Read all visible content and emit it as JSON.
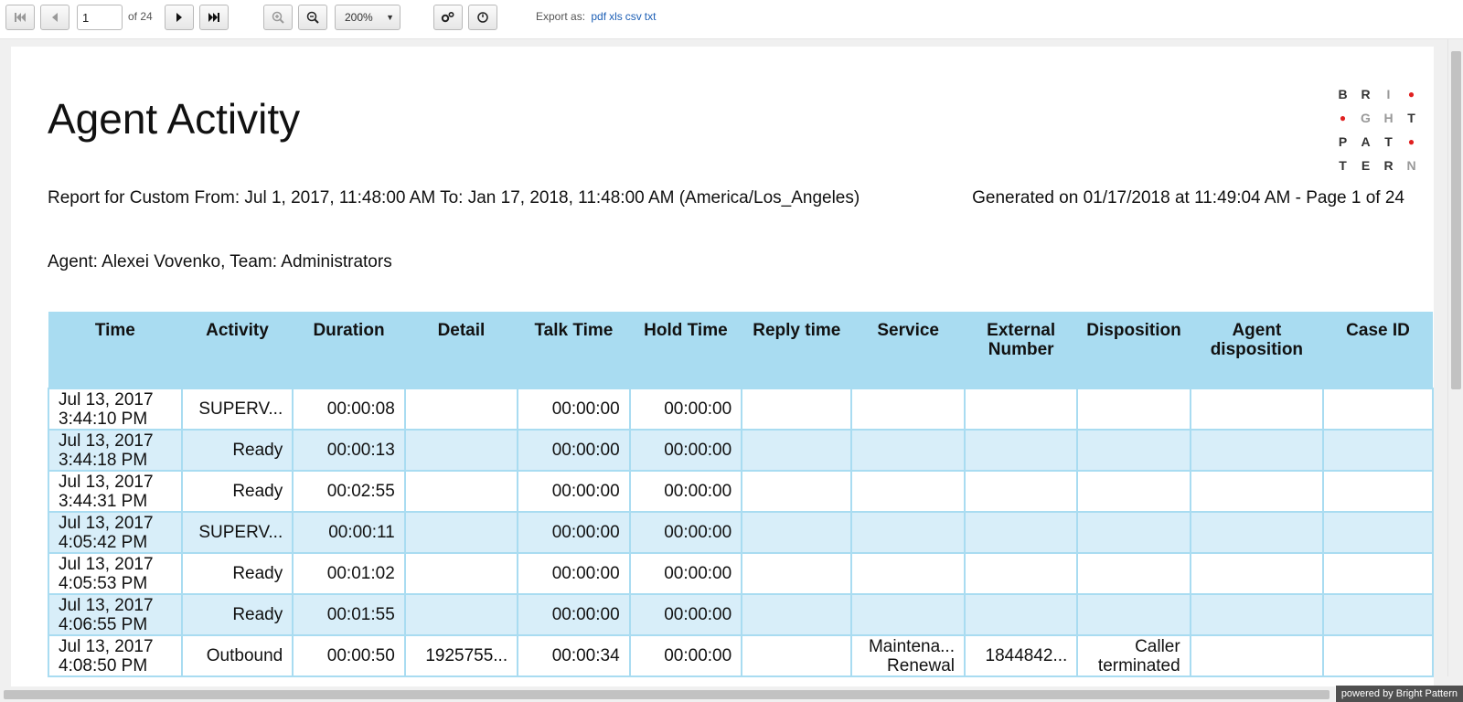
{
  "toolbar": {
    "page_value": "1",
    "page_of": "of 24",
    "zoom": "200%",
    "export_label": "Export as:",
    "export_formats": [
      "pdf",
      "xls",
      "csv",
      "txt"
    ],
    "icons": {
      "first": "first-page-icon",
      "prev": "prev-page-icon",
      "next": "next-page-icon",
      "last": "last-page-icon",
      "zoom_in": "zoom-in-icon",
      "zoom_out": "zoom-out-icon",
      "settings": "settings-icon",
      "refresh": "refresh-icon"
    }
  },
  "report": {
    "title": "Agent Activity",
    "range": "Report for Custom From: Jul 1, 2017, 11:48:00 AM To: Jan 17, 2018, 11:48:00 AM (America/Los_Angeles)",
    "generated": "Generated on 01/17/2018 at 11:49:04 AM - Page 1 of 24",
    "agent": "Agent: Alexei Vovenko, Team: Administrators",
    "logo_text": "BRIGHT PATTERN"
  },
  "table": {
    "columns": [
      "Time",
      "Activity",
      "Duration",
      "Detail",
      "Talk Time",
      "Hold Time",
      "Reply time",
      "Service",
      "External Number",
      "Disposition",
      "Agent disposition",
      "Case ID"
    ],
    "rows": [
      [
        "Jul 13, 2017 3:44:10 PM",
        "SUPERV...",
        "00:00:08",
        "",
        "00:00:00",
        "00:00:00",
        "",
        "",
        "",
        "",
        "",
        ""
      ],
      [
        "Jul 13, 2017 3:44:18 PM",
        "Ready",
        "00:00:13",
        "",
        "00:00:00",
        "00:00:00",
        "",
        "",
        "",
        "",
        "",
        ""
      ],
      [
        "Jul 13, 2017 3:44:31 PM",
        "Ready",
        "00:02:55",
        "",
        "00:00:00",
        "00:00:00",
        "",
        "",
        "",
        "",
        "",
        ""
      ],
      [
        "Jul 13, 2017 4:05:42 PM",
        "SUPERV...",
        "00:00:11",
        "",
        "00:00:00",
        "00:00:00",
        "",
        "",
        "",
        "",
        "",
        ""
      ],
      [
        "Jul 13, 2017 4:05:53 PM",
        "Ready",
        "00:01:02",
        "",
        "00:00:00",
        "00:00:00",
        "",
        "",
        "",
        "",
        "",
        ""
      ],
      [
        "Jul 13, 2017 4:06:55 PM",
        "Ready",
        "00:01:55",
        "",
        "00:00:00",
        "00:00:00",
        "",
        "",
        "",
        "",
        "",
        ""
      ],
      [
        "Jul 13, 2017 4:08:50 PM",
        "Outbound",
        "00:00:50",
        "1925755...",
        "00:00:34",
        "00:00:00",
        "",
        "Maintena... Renewal",
        "1844842...",
        "Caller terminated",
        "",
        ""
      ]
    ]
  },
  "footer": {
    "powered_by": "powered by Bright Pattern"
  },
  "colors": {
    "header_bg": "#a9dcf1",
    "alt_row_bg": "#d8eef9",
    "link": "#1d5fb5",
    "logo_dot": "#e02020"
  }
}
